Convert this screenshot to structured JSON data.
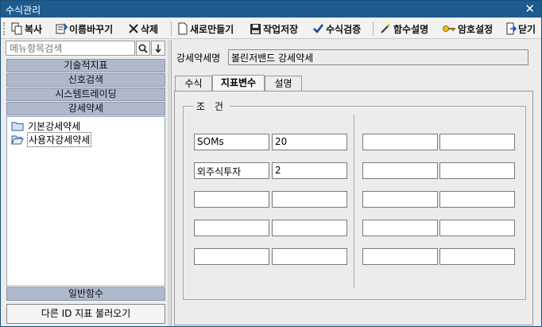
{
  "window": {
    "title": "수식관리"
  },
  "toolbar": {
    "copy": "복사",
    "rename": "이름바꾸기",
    "delete": "삭제",
    "new": "새로만들기",
    "save": "작업저장",
    "verify": "수식검증",
    "func_help": "함수설명",
    "password": "암호설정",
    "close": "닫기"
  },
  "left": {
    "search_placeholder": "메뉴항목검색",
    "categories": [
      "기술적지표",
      "신호검색",
      "시스템트레이딩",
      "강세약세"
    ],
    "tree": [
      "기본강세약세",
      "사용자강세약세"
    ],
    "general_functions": "일반함수",
    "load_other": "다른 ID 지표 불러오기"
  },
  "right": {
    "name_label": "강세약세명",
    "name_value": "볼린저밴드 강세약세",
    "tabs": [
      "수식",
      "지표변수",
      "설명"
    ],
    "active_tab": "지표변수",
    "group_title": "조 건",
    "rows": [
      [
        "SOMs",
        "20",
        "",
        ""
      ],
      [
        "외주식투자",
        "2",
        "",
        ""
      ],
      [
        "",
        "",
        "",
        ""
      ],
      [
        "",
        "",
        "",
        ""
      ],
      [
        "",
        "",
        "",
        ""
      ]
    ]
  },
  "colors": {
    "titlebar": "#1e5b8e",
    "category": "#aeb9cc"
  }
}
